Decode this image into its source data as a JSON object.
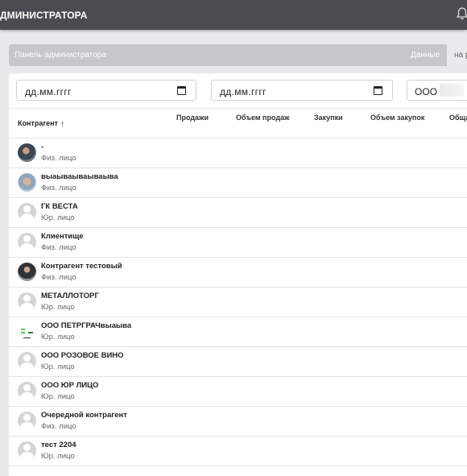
{
  "topbar": {
    "title": "ДМИНИСТРАТОРА",
    "bell_icon": "bell-icon"
  },
  "breadcrumb": {
    "panel": "Панель администратора",
    "data": "Данные",
    "tab": "на р"
  },
  "filters": {
    "date_from": "дд.мм.гггг",
    "date_to": "дд.мм.гггг",
    "organization": "ООО \""
  },
  "table": {
    "columns": {
      "counterparty": "Контрагент",
      "sales": "Продажи",
      "sales_volume": "Объем продаж",
      "purchases": "Закупки",
      "purchases_volume": "Объем закупок",
      "total": "Обща"
    },
    "rows": [
      {
        "name": "-",
        "type": "Физ. лицо",
        "avatar": "photo1"
      },
      {
        "name": "выаываываываыва",
        "type": "Физ. лицо",
        "avatar": "photo2"
      },
      {
        "name": "ГК ВЕСТА",
        "type": "Юр. лицо",
        "avatar": "default"
      },
      {
        "name": "Клиентище",
        "type": "Физ. лицо",
        "avatar": "default"
      },
      {
        "name": "Контрагент тестовый",
        "type": "Физ. лицо",
        "avatar": "photo3"
      },
      {
        "name": "МЕТАЛЛОТОРГ",
        "type": "Юр. лицо",
        "avatar": "default"
      },
      {
        "name": "ООО ПЕТРГРАЧвыаыва",
        "type": "Юр. лицо",
        "avatar": "logo"
      },
      {
        "name": "ООО РОЗОВОЕ ВИНО",
        "type": "Юр. лицо",
        "avatar": "default"
      },
      {
        "name": "ООО ЮР ЛИЦО",
        "type": "Юр. лицо",
        "avatar": "default"
      },
      {
        "name": "Очередной контрагент",
        "type": "Физ. лицо",
        "avatar": "default"
      },
      {
        "name": "тест 2204",
        "type": "Юр. лицо",
        "avatar": "default"
      }
    ]
  }
}
